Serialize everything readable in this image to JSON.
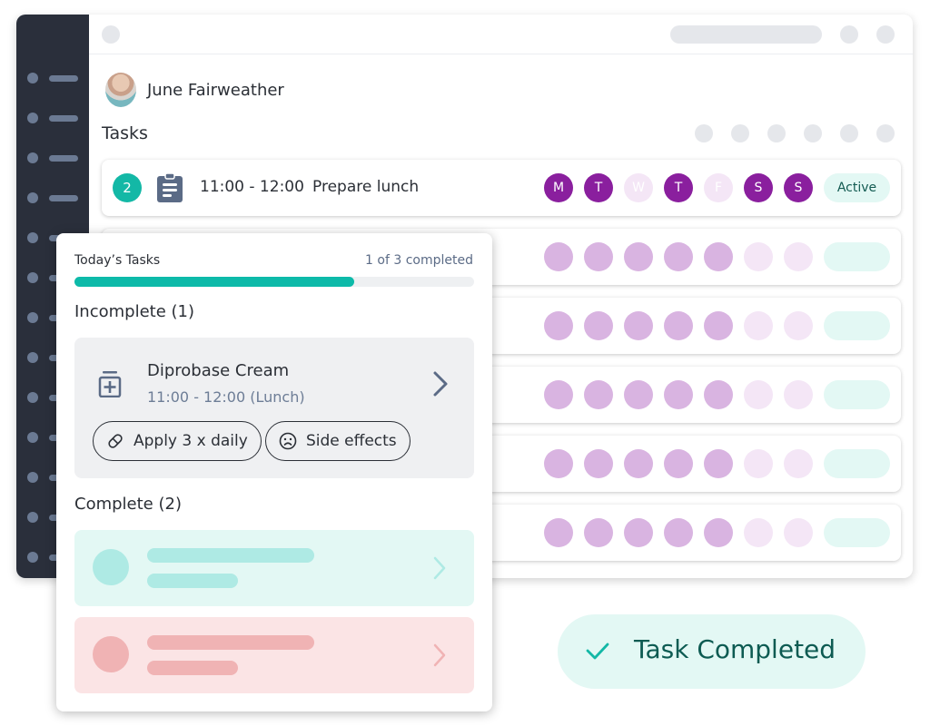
{
  "app": {
    "sidebar": {
      "item_count": 13
    },
    "user": {
      "name": "June Fairweather",
      "avatar_icon": "user-photo"
    },
    "tasks_title": "Tasks",
    "active_task": {
      "number": "2",
      "icon": "clipboard-icon",
      "time": "11:00 - 12:00",
      "label": "Prepare lunch",
      "days": [
        {
          "letter": "M",
          "active": true
        },
        {
          "letter": "T",
          "active": true
        },
        {
          "letter": "W",
          "active": false
        },
        {
          "letter": "T",
          "active": true
        },
        {
          "letter": "F",
          "active": false
        },
        {
          "letter": "S",
          "active": true
        },
        {
          "letter": "S",
          "active": true
        }
      ],
      "status": "Active"
    },
    "placeholder_rows": 5
  },
  "panel": {
    "title": "Today’s Tasks",
    "count": "1 of 3 completed",
    "progress_percent": 70,
    "incomplete_title": "Incomplete (1)",
    "incomplete_item": {
      "name": "Diprobase Cream",
      "time": "11:00 - 12:00 (Lunch)",
      "chips": [
        {
          "icon": "pill-icon",
          "label": "Apply 3 x daily"
        },
        {
          "icon": "sad-face-icon",
          "label": "Side effects"
        }
      ]
    },
    "complete_title": "Complete (2)"
  },
  "toast": {
    "text": "Task Completed",
    "icon": "check-icon"
  },
  "colors": {
    "teal": "#13b8a6",
    "purple": "#8a1f9e",
    "purple_light": "#d9b4e1",
    "purple_faint": "#f4e6f6",
    "sidebar": "#2a2f3b",
    "success_bg": "#e3f8f4",
    "error_bg": "#fbe4e5"
  }
}
